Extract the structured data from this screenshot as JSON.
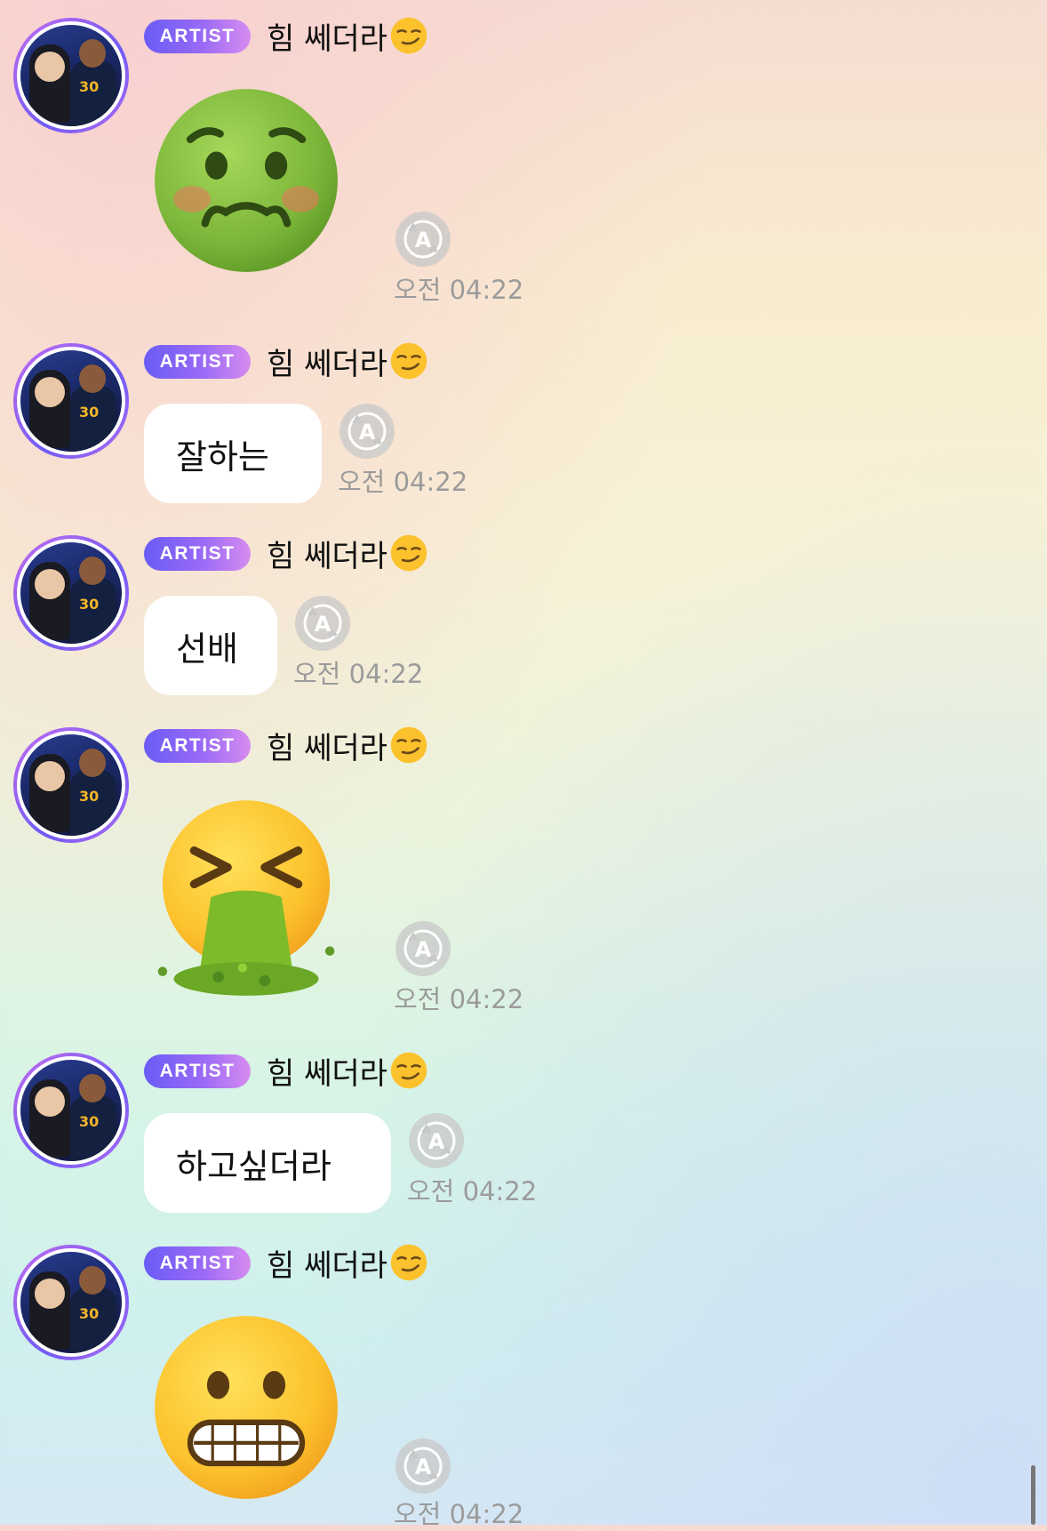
{
  "sender": {
    "badge": "ARTIST",
    "name": "힘 쎄더라",
    "name_emoji_icon": "smirking-face-emoji"
  },
  "messages": [
    {
      "type": "emoji",
      "emoji_icon": "nauseated-face-emoji",
      "time": "오전 04:22"
    },
    {
      "type": "text",
      "text": "잘하는",
      "time": "오전 04:22"
    },
    {
      "type": "text",
      "text": "선배",
      "time": "오전 04:22"
    },
    {
      "type": "emoji",
      "emoji_icon": "vomiting-face-emoji",
      "time": "오전 04:22"
    },
    {
      "type": "text",
      "text": "하고싶더라",
      "time": "오전 04:22"
    },
    {
      "type": "emoji",
      "emoji_icon": "grimacing-face-emoji",
      "time": "오전 04:22"
    }
  ],
  "icons": {
    "translate": "auto-translate-icon"
  },
  "colors": {
    "badge_gradient_start": "#6a5cf6",
    "badge_gradient_end": "#d78cf0",
    "timestamp": "#9b9b9b",
    "bubble": "#ffffff"
  }
}
